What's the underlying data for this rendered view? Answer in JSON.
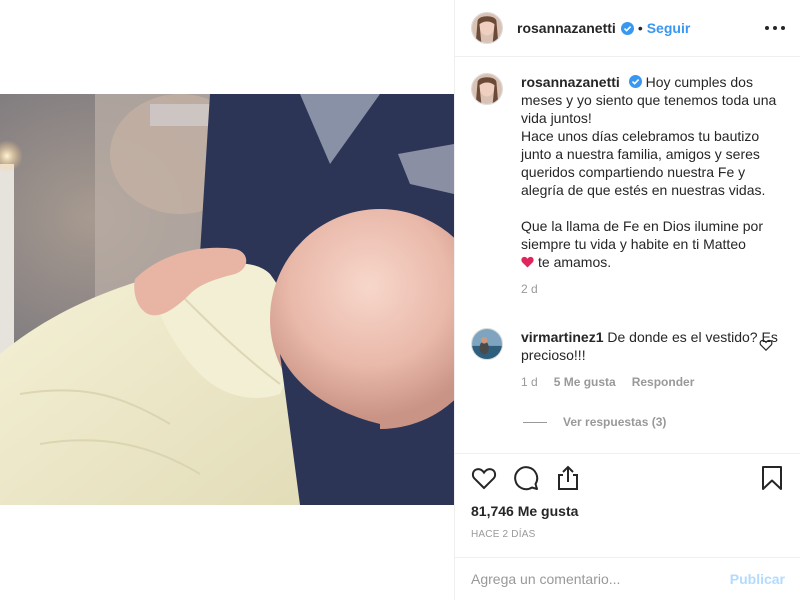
{
  "post": {
    "username": "rosannazanetti",
    "verified": true,
    "follow_label": "Seguir",
    "dot": "•",
    "more_icon": "more-horizontal-icon"
  },
  "caption": {
    "username": "rosannazanetti",
    "text": "Hoy cumples dos meses y yo siento que tenemos toda una vida juntos!\nHace unos días celebramos tu bautizo junto a nuestra familia, amigos y seres queridos compartiendo nuestra Fe y alegría de que estés en nuestras vidas.\n\nQue la llama de Fe en Dios ilumine por siempre tu vida y habite en ti Matteo\n",
    "text_end": "te amamos.",
    "time": "2 d"
  },
  "comments": [
    {
      "username": "virmartinez1",
      "text": "De donde es el vestido? Es precioso!!!",
      "time": "1 d",
      "likes": "5 Me gusta",
      "reply_label": "Responder",
      "view_replies": "Ver respuestas (3)"
    }
  ],
  "actions": {
    "icons": [
      "heart-icon",
      "comment-icon",
      "share-icon",
      "bookmark-icon"
    ],
    "likes_count": "81,746 Me gusta",
    "time_ago": "HACE 2 DÍAS"
  },
  "add_comment": {
    "placeholder": "Agrega un comentario...",
    "publish_label": "Publicar"
  },
  "colors": {
    "accent": "#3897f0",
    "publish_disabled": "#b3dbff",
    "heart_red": "#e0245e",
    "muted": "#999999",
    "text": "#262626"
  }
}
